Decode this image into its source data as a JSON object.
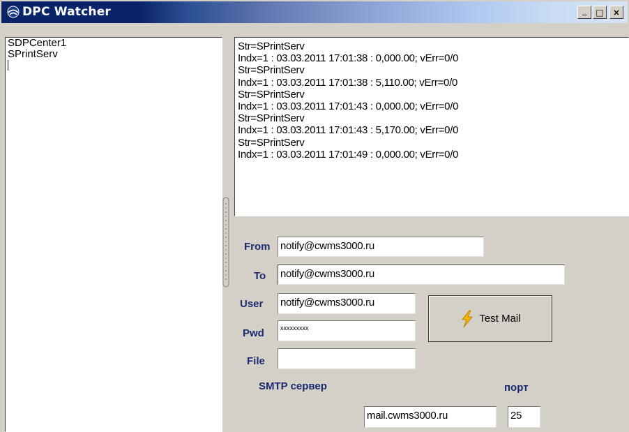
{
  "window": {
    "title": "DPC Watcher",
    "controls": {
      "minimize": "_",
      "maximize": "□",
      "close": "×"
    }
  },
  "services_list": {
    "items": [
      "SDPCenter1",
      "SPrintServ"
    ]
  },
  "log": {
    "lines": [
      "Str=SPrintServ",
      "Indx=1 : 03.03.2011 17:01:38 : 0,000.00; vErr=0/0",
      "Str=SPrintServ",
      "Indx=1 : 03.03.2011 17:01:38 : 5,110.00; vErr=0/0",
      "Str=SPrintServ",
      "Indx=1 : 03.03.2011 17:01:43 : 0,000.00; vErr=0/0",
      "Str=SPrintServ",
      "Indx=1 : 03.03.2011 17:01:43 : 5,170.00; vErr=0/0",
      "Str=SPrintServ",
      "Indx=1 : 03.03.2011 17:01:49 : 0,000.00; vErr=0/0"
    ]
  },
  "mail_form": {
    "from_label": "From",
    "from_value": "notify@cwms3000.ru",
    "to_label": "To",
    "to_value": "notify@cwms3000.ru",
    "user_label": "User",
    "user_value": "notify@cwms3000.ru",
    "pwd_label": "Pwd",
    "pwd_value": "xxxxxxxxx",
    "file_label": "File",
    "file_value": "",
    "smtp_label": "SMTP сервер",
    "smtp_value": "mail.cwms3000.ru",
    "port_label": "порт",
    "port_value": "25",
    "test_button_label": "Test Mail"
  },
  "colors": {
    "title_bar": "#0a246a",
    "label_text": "#1a2a6e",
    "lightning": "#f5b400"
  }
}
